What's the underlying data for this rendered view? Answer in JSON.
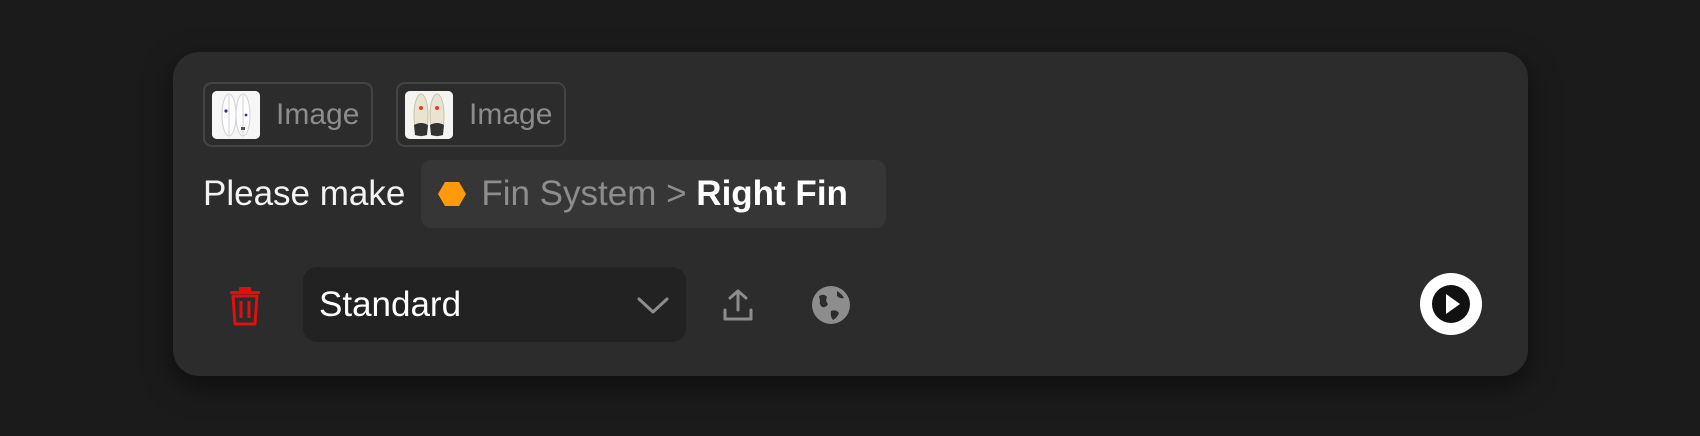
{
  "attachments": [
    {
      "label": "Image",
      "thumb": "surfboard-thumbnail"
    },
    {
      "label": "Image",
      "thumb": "surfboard-thumbnail"
    }
  ],
  "prompt": {
    "text": "Please make",
    "reference": {
      "icon": "hexagon-icon",
      "icon_color": "#ff9b0a",
      "parent": "Fin System",
      "separator": ">",
      "leaf": "Right Fin"
    }
  },
  "toolbar": {
    "delete_icon": "trash-icon",
    "delete_color": "#e01010",
    "mode_select": {
      "value": "Standard"
    },
    "upload_icon": "upload-icon",
    "globe_icon": "globe-icon",
    "run_icon": "play-icon"
  }
}
